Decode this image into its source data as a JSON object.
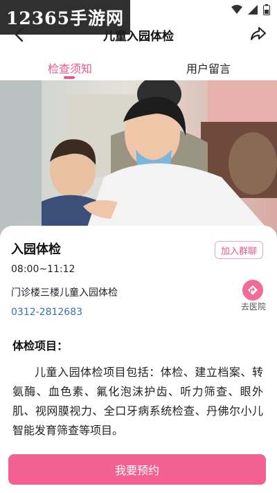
{
  "watermark": "12365手游网",
  "header": {
    "title": "儿童入园体检"
  },
  "tabs": [
    {
      "label": "检查须知"
    },
    {
      "label": "用户留言"
    }
  ],
  "colors": {
    "accent": "#f0568c",
    "button": "#f26191",
    "phone": "#3a6db5"
  },
  "card": {
    "title": "入园体检",
    "join_label": "加入群聊",
    "time": "08:00~11:12",
    "location": "门诊楼三楼儿童入园体检",
    "phone": "0312-2812683",
    "go_hospital_label": "去医院",
    "section_title": "体检项目：",
    "description": "儿童入园体检项目包括：体检、建立档案、转氨酶、血色素、氟化泡沫护齿、听力筛查、眼外肌、视网膜视力、全口牙病系统检查、丹佛尔小儿智能发育筛查等项目。"
  },
  "footer": {
    "book_label": "我要预约"
  },
  "icons": [
    "back-arrow-icon",
    "share-icon",
    "navigation-arrow-icon",
    "wifi-icon",
    "signal-icon",
    "battery-icon"
  ]
}
